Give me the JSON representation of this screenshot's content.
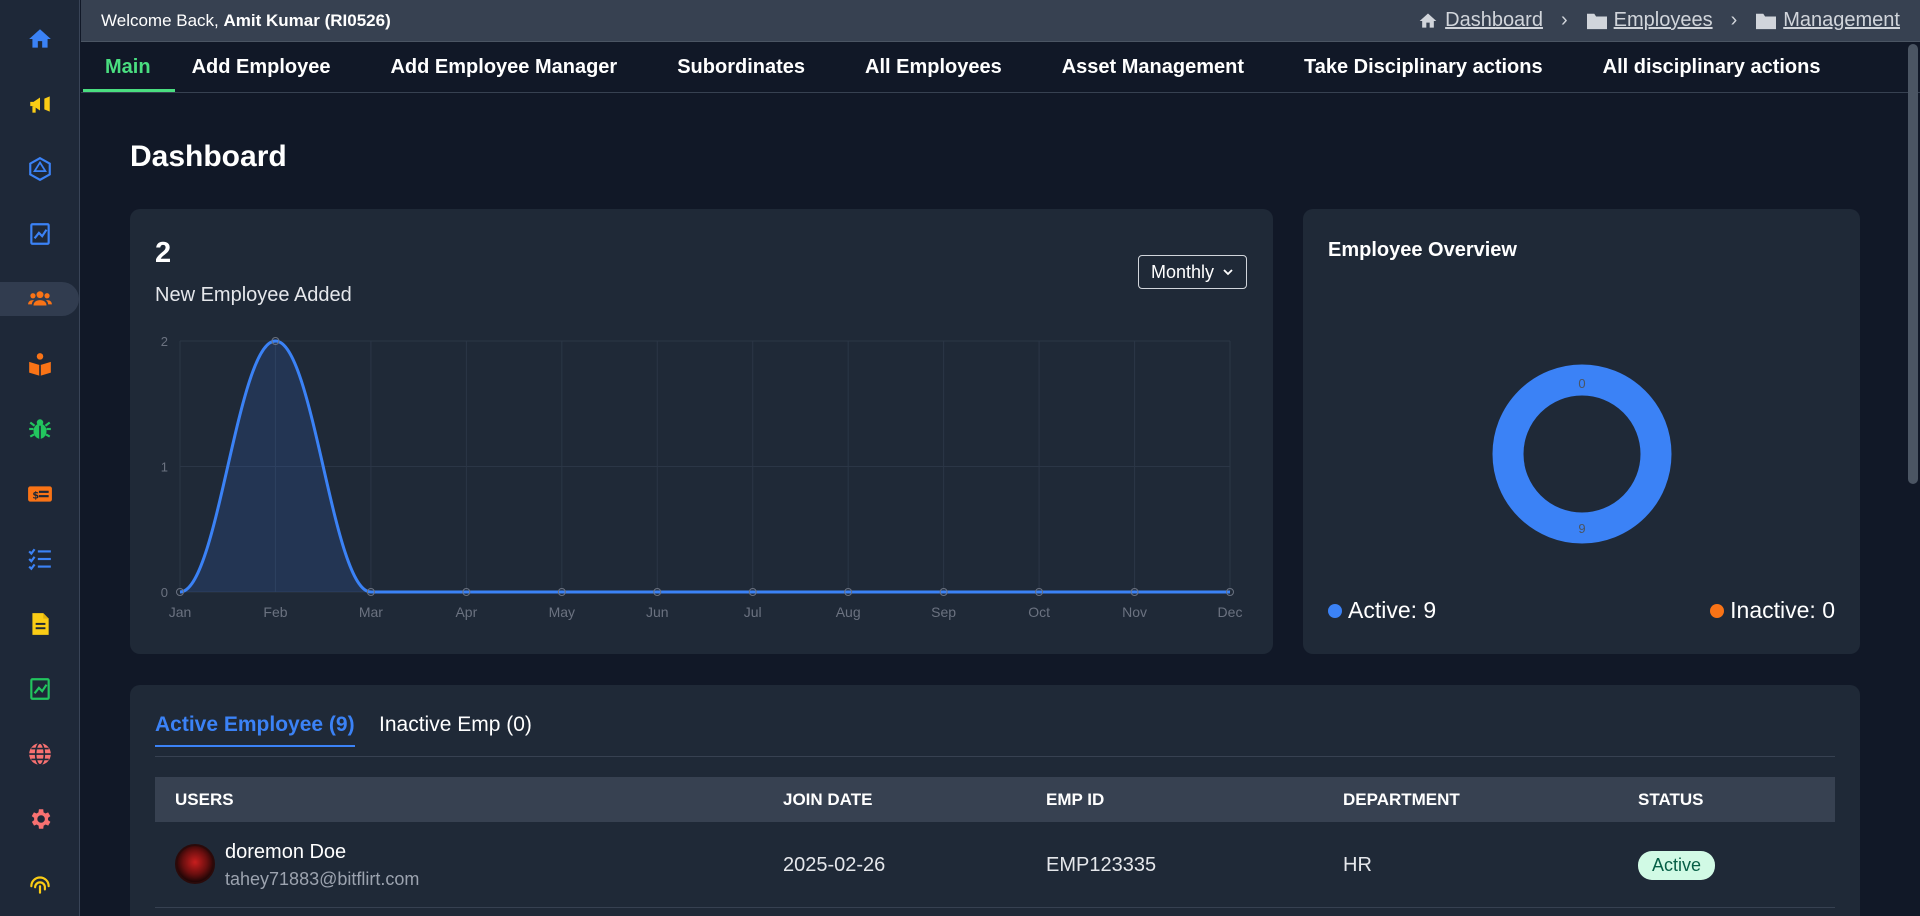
{
  "header": {
    "welcome_prefix": "Welcome Back,",
    "user_name": "Amit Kumar (RI0526)",
    "breadcrumb": [
      "Dashboard",
      "Employees",
      "Management"
    ]
  },
  "sidebar": {
    "icons": [
      {
        "name": "home-icon",
        "color": "#3b82f6"
      },
      {
        "name": "megaphone-icon",
        "color": "#facc15"
      },
      {
        "name": "dice-icon",
        "color": "#3b82f6"
      },
      {
        "name": "chart-file-icon",
        "color": "#3b82f6"
      },
      {
        "name": "users-icon",
        "color": "#f97316"
      },
      {
        "name": "book-reader-icon",
        "color": "#f97316"
      },
      {
        "name": "bug-icon",
        "color": "#22c55e"
      },
      {
        "name": "money-card-icon",
        "color": "#f97316"
      },
      {
        "name": "checklist-icon",
        "color": "#3b82f6"
      },
      {
        "name": "document-icon",
        "color": "#facc15"
      },
      {
        "name": "chart-file-green-icon",
        "color": "#22c55e"
      },
      {
        "name": "globe-icon",
        "color": "#f87171"
      },
      {
        "name": "gear-icon",
        "color": "#f87171"
      },
      {
        "name": "fingerprint-icon",
        "color": "#facc15"
      }
    ]
  },
  "nav": {
    "tabs": [
      "Main",
      "Add Employee",
      "Add Employee Manager",
      "Subordinates",
      "All Employees",
      "Asset Management",
      "Take Disciplinary actions",
      "All disciplinary actions"
    ]
  },
  "page": {
    "title": "Dashboard"
  },
  "stats": {
    "count": "2",
    "label": "New Employee Added",
    "period": "Monthly"
  },
  "chart_data": [
    {
      "type": "area",
      "categories": [
        "Jan",
        "Feb",
        "Mar",
        "Apr",
        "May",
        "Jun",
        "Jul",
        "Aug",
        "Sep",
        "Oct",
        "Nov",
        "Dec"
      ],
      "series": [
        {
          "values": [
            0,
            2,
            0,
            0,
            0,
            0,
            0,
            0,
            0,
            0,
            0,
            0
          ]
        }
      ],
      "ylim": [
        0,
        2
      ],
      "yticks": [
        "0",
        "1",
        "2"
      ],
      "grid": true,
      "color": "#3b82f6"
    },
    {
      "type": "pie",
      "title": "Employee Overview",
      "labels": [
        "Active",
        "Inactive"
      ],
      "values": [
        9,
        0
      ],
      "slice_labels": [
        "9",
        "0"
      ],
      "colors": [
        "#3b82f6",
        "#f97316"
      ],
      "legend": [
        "Active: 9",
        "Inactive: 0"
      ]
    }
  ],
  "overview": {
    "title": "Employee Overview",
    "active_label": "Active: 9",
    "inactive_label": "Inactive: 0"
  },
  "employees": {
    "tabs": [
      "Active Employee (9)",
      "Inactive Emp (0)"
    ],
    "columns": [
      "USERS",
      "JOIN DATE",
      "EMP ID",
      "DEPARTMENT",
      "STATUS"
    ],
    "rows": [
      {
        "name": "doremon Doe",
        "email": "tahey71883@bitflirt.com",
        "join_date": "2025-02-26",
        "emp_id": "EMP123335",
        "department": "HR",
        "status": "Active"
      }
    ]
  }
}
